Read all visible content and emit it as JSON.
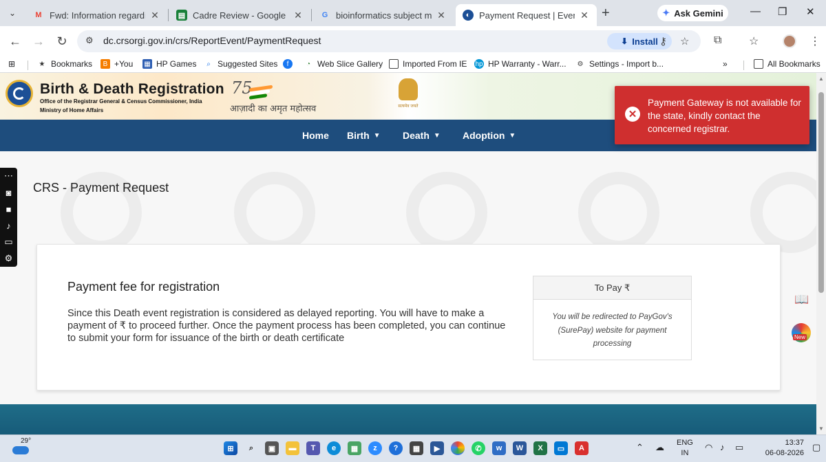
{
  "browser": {
    "tabs": [
      {
        "title": "Fwd: Information regarding",
        "icon": "gmail-icon",
        "color": "#ea4335"
      },
      {
        "title": "Cadre Review - Google Shee",
        "icon": "sheets-icon",
        "color": "#188038"
      },
      {
        "title": "bioinformatics subject matte",
        "icon": "google-icon",
        "color": "#4285f4"
      },
      {
        "title": "Payment Request | Events | C",
        "icon": "crs-icon",
        "color": "#1c4f96"
      }
    ],
    "ask_gemini": "Ask Gemini",
    "url": "dc.crsorgi.gov.in/crs/ReportEvent/PaymentRequest",
    "install_label": "Install"
  },
  "bookmarks": {
    "items": [
      {
        "label": "Bookmarks",
        "icon": "star-icon"
      },
      {
        "label": "+You",
        "icon": "blogger-icon"
      },
      {
        "label": "HP Games",
        "icon": "hp-games-icon"
      },
      {
        "label": "Suggested Sites",
        "icon": "search-icon"
      },
      {
        "label": "",
        "icon": "facebook-icon"
      },
      {
        "label": "Web Slice Gallery",
        "icon": "web-slice-icon"
      },
      {
        "label": "Imported From IE",
        "icon": "folder-icon"
      },
      {
        "label": "HP Warranty - Warr...",
        "icon": "hp-icon"
      },
      {
        "label": "Settings - Import b...",
        "icon": "settings-icon"
      }
    ],
    "all_bookmarks": "All Bookmarks"
  },
  "site": {
    "title": "Birth & Death Registration",
    "subtitle1": "Office of the Registrar General & Census Commissioner, India",
    "subtitle2": "Ministry of Home Affairs",
    "akam_number": "75",
    "akam_text": "आज़ादी का अमृत महोत्सव",
    "emblem_text": "सत्यमेव जयते",
    "nav": [
      {
        "label": "Home",
        "dropdown": false
      },
      {
        "label": "Birth",
        "dropdown": true
      },
      {
        "label": "Death",
        "dropdown": true
      },
      {
        "label": "Adoption",
        "dropdown": true
      }
    ]
  },
  "page": {
    "title": "CRS - Payment Request",
    "card": {
      "heading": "Payment fee for registration",
      "body": "Since this Death event registration is considered as delayed reporting. You will have to make a payment of ₹ to proceed further. Once the payment process has been completed, you can continue to submit your form for issuance of the birth or death certificate",
      "pay_header": "To Pay ₹",
      "pay_note": "You will be redirected to PayGov's (SurePay) website for payment processing"
    }
  },
  "toast": {
    "message": "Payment Gateway is not available for the state, kindly contact the concerned registrar.",
    "color": "#cf2f2f"
  },
  "side_widget": {
    "badge": "New"
  },
  "taskbar": {
    "temperature": "29°",
    "language_line1": "ENG",
    "language_line2": "IN",
    "time": "13:37",
    "date": "06-08-2026"
  },
  "colors": {
    "nav_bg": "#1e4d7d",
    "footer_band": "#1f6d88",
    "accent_blue": "#1a73e8"
  }
}
